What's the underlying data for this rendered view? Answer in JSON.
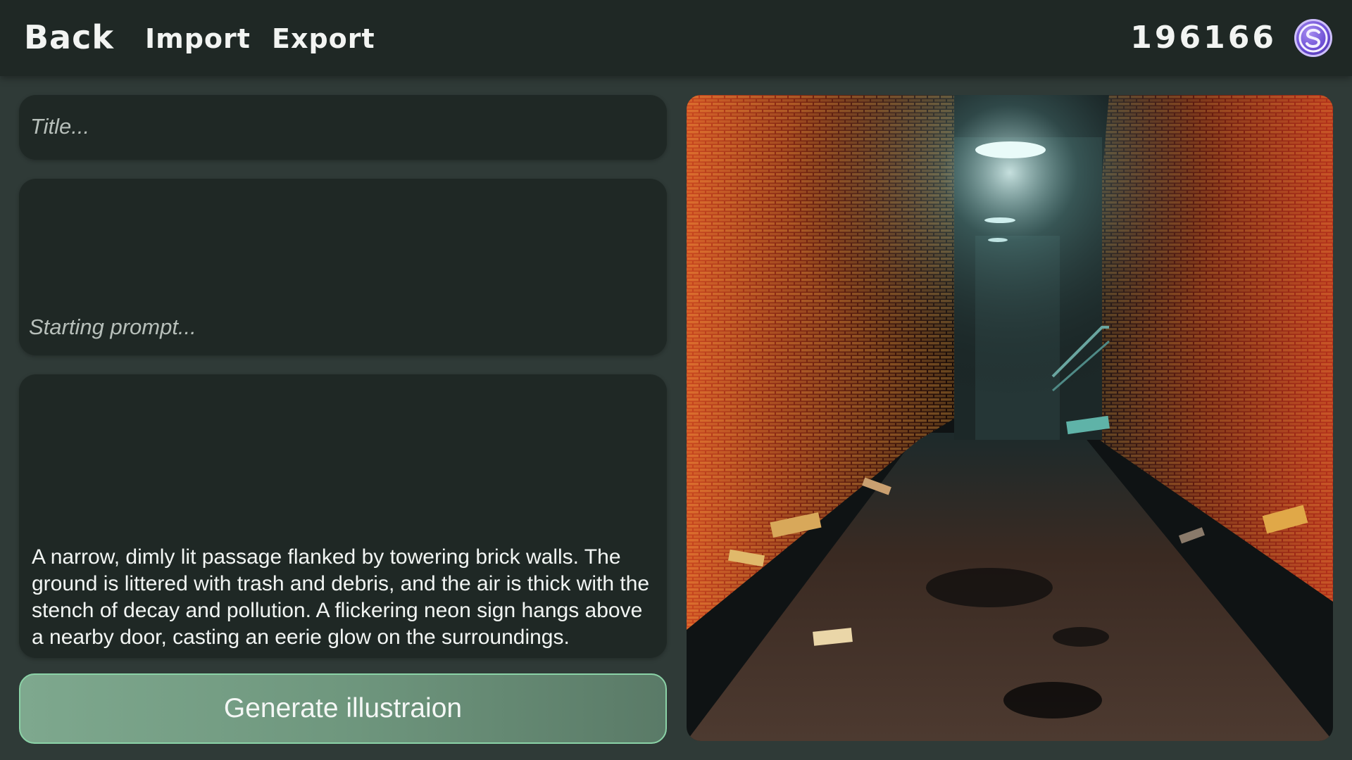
{
  "topbar": {
    "back_label": "Back",
    "import_label": "Import",
    "export_label": "Export",
    "credits": "196166",
    "coin_icon": "credit-coin-icon"
  },
  "form": {
    "title_placeholder": "Title...",
    "prompt_placeholder": "Starting prompt...",
    "description": "A narrow, dimly lit passage flanked by towering brick walls. The ground is littered with trash and debris, and the air is thick with the stench of decay and pollution. A flickering neon sign hangs above a nearby door, casting an eerie glow on the surroundings.",
    "generate_label": "Generate illustraion"
  },
  "colors": {
    "background": "#2f3a37",
    "panel": "#1f2825",
    "button": "#7ea88e",
    "button_border": "#8bd3a7",
    "coin": "#6a4bd3"
  }
}
